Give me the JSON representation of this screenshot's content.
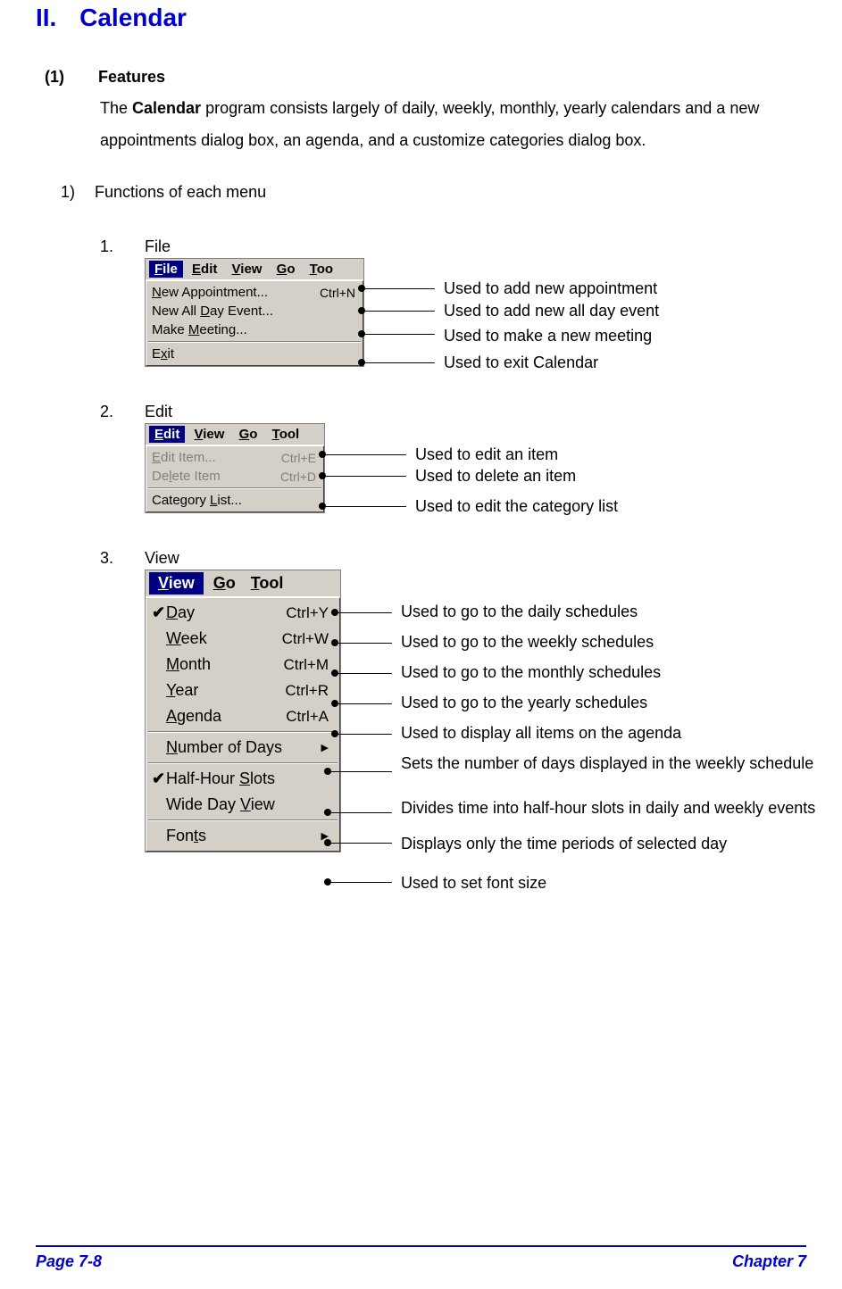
{
  "title": {
    "num": "II.",
    "text": "Calendar"
  },
  "features": {
    "num": "(1)",
    "label": "Features",
    "body_before": "The ",
    "body_bold": "Calendar",
    "body_after": " program consists largely of daily, weekly, monthly, yearly calendars and a new appointments dialog box, an agenda, and a customize categories dialog box."
  },
  "functions": {
    "num": "1)",
    "label": "Functions of each menu"
  },
  "file": {
    "num": "1.",
    "label": "File",
    "bar": [
      "File",
      "Edit",
      "View",
      "Go",
      "Too"
    ],
    "rows": [
      {
        "label": "New Appointment...",
        "shortcut": "Ctrl+N",
        "ann": "Used to add new appointment"
      },
      {
        "label": "New All Day Event...",
        "shortcut": "",
        "ann": "Used to add new all day event"
      },
      {
        "label": "Make Meeting...",
        "shortcut": "",
        "ann": "Used to make a new meeting"
      },
      {
        "label": "Exit",
        "shortcut": "",
        "ann": "Used to exit Calendar"
      }
    ]
  },
  "edit": {
    "num": "2.",
    "label": "Edit",
    "bar": [
      "Edit",
      "View",
      "Go",
      "Tool"
    ],
    "rows": [
      {
        "label": "Edit Item...",
        "shortcut": "Ctrl+E",
        "disabled": true,
        "ann": "Used to edit an item"
      },
      {
        "label": "Delete Item",
        "shortcut": "Ctrl+D",
        "disabled": true,
        "ann": "Used to delete an item"
      },
      {
        "label": "Category List...",
        "shortcut": "",
        "ann": "Used to edit the category list"
      }
    ]
  },
  "view": {
    "num": "3.",
    "label": "View",
    "bar": [
      "View",
      "Go",
      "Tool"
    ],
    "rows": [
      {
        "label": "Day",
        "shortcut": "Ctrl+Y",
        "checked": true,
        "ann": "Used to go to the daily schedules"
      },
      {
        "label": "Week",
        "shortcut": "Ctrl+W",
        "ann": "Used to go to the weekly schedules"
      },
      {
        "label": "Month",
        "shortcut": "Ctrl+M",
        "ann": "Used to go to the monthly schedules"
      },
      {
        "label": "Year",
        "shortcut": "Ctrl+R",
        "ann": "Used to go to the yearly schedules"
      },
      {
        "label": "Agenda",
        "shortcut": "Ctrl+A",
        "ann": "Used to display all items on the agenda"
      },
      {
        "sep": true
      },
      {
        "label": "Number of Days",
        "submenu": true,
        "ann": "Sets the number of days displayed in the weekly schedule",
        "wrap": true
      },
      {
        "sep": true
      },
      {
        "label": "Half-Hour Slots",
        "checked": true,
        "ann": "Divides time into half-hour slots in daily and weekly events",
        "wrap": true
      },
      {
        "label": "Wide Day View",
        "ann": "Displays only the time periods of selected day"
      },
      {
        "sep": true
      },
      {
        "label": "Fonts",
        "submenu": true,
        "ann": "Used to set font size"
      }
    ]
  },
  "footer": {
    "left": "Page 7-8",
    "right": "Chapter 7"
  }
}
